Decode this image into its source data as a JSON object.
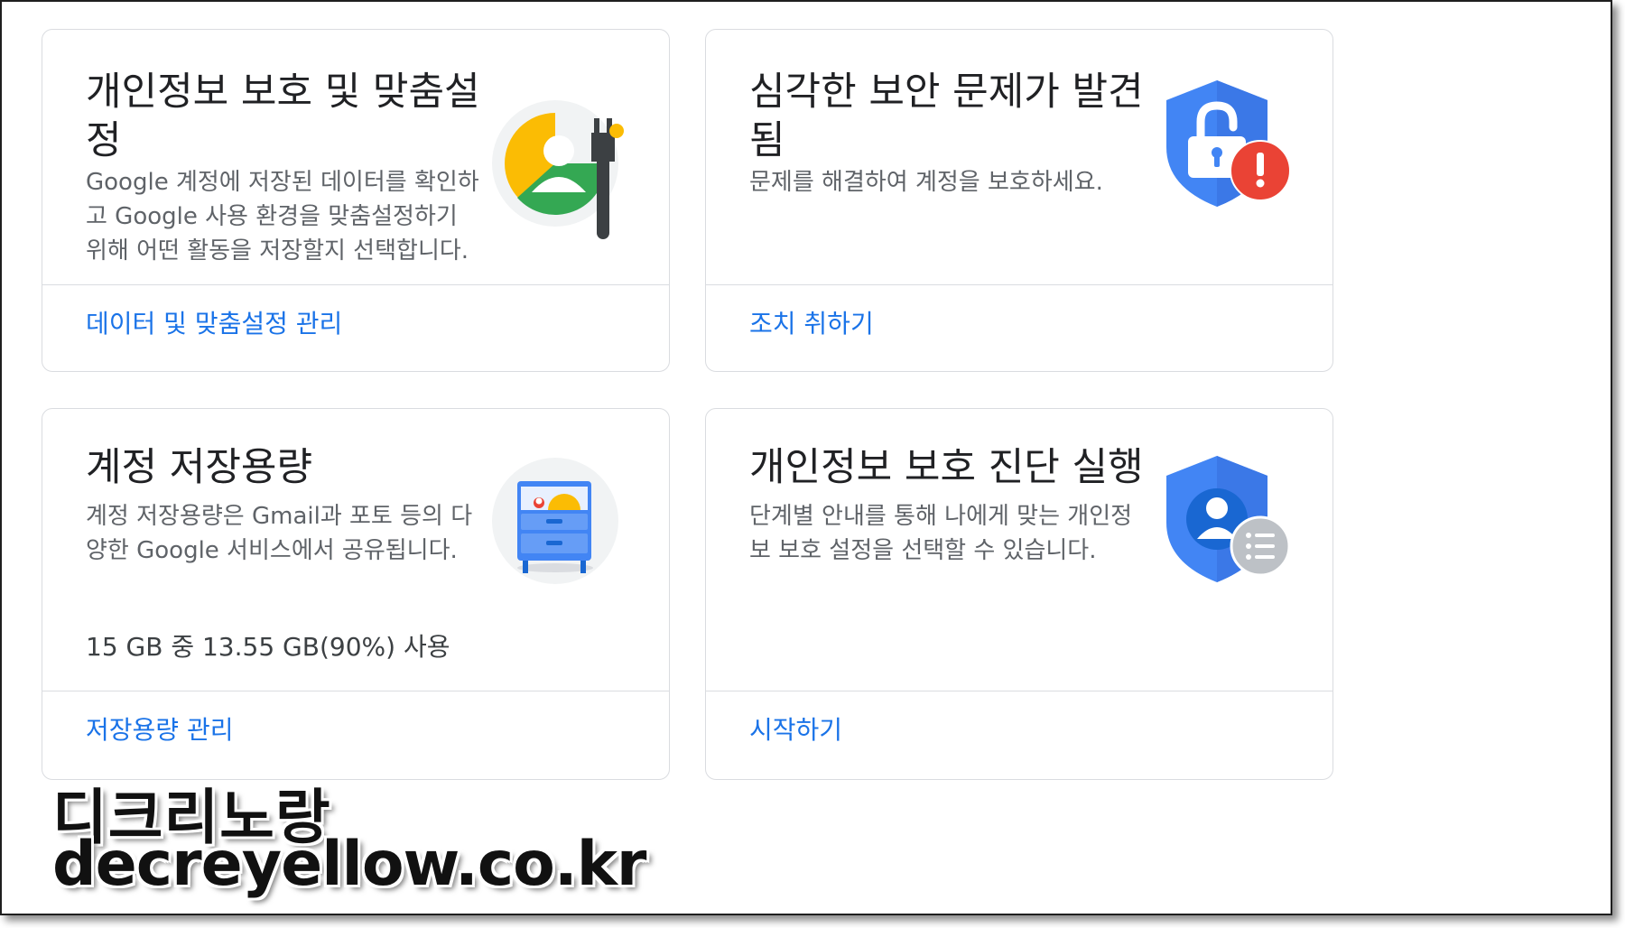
{
  "cards": [
    {
      "title_line1": "개인정보 보호 및 맞춤설",
      "title_line2": "정",
      "description_lines": [
        "Google 계정에 저장된 데이터를 확인하",
        "고 Google 사용 환경을 맞춤설정하기",
        "위해 어떤 활동을 저장할지 선택합니다."
      ],
      "action": "데이터 및 맞춤설정 관리",
      "icon": "privacy-personalization-icon"
    },
    {
      "title_line1": "심각한 보안 문제가 발견",
      "title_line2": "됨",
      "description_lines": [
        "문제를 해결하여 계정을 보호하세요."
      ],
      "action": "조치 취하기",
      "icon": "security-alert-shield-icon"
    },
    {
      "title_line1": "계정 저장용량",
      "description_lines": [
        "계정 저장용량은 Gmail과 포토 등의 다",
        "양한 Google 서비스에서 공유됩니다."
      ],
      "usage": "15 GB 중 13.55 GB(90%) 사용",
      "usage_fraction": 0.9,
      "action": "저장용량 관리",
      "icon": "storage-drawer-icon"
    },
    {
      "title_line1": "개인정보 보호 진단 실행",
      "description_lines": [
        "단계별 안내를 통해 나에게 맞는 개인정",
        "보 보호 설정을 선택할 수 있습니다."
      ],
      "action": "시작하기",
      "icon": "privacy-checkup-shield-icon"
    }
  ],
  "watermark": {
    "line1": "디크리노랑",
    "line2": "decreyellow.co.kr"
  },
  "colors": {
    "link": "#1a73e8",
    "google_blue": "#4285f4",
    "google_red": "#ea4335",
    "google_yellow": "#fbbc04",
    "google_green": "#34a853"
  }
}
